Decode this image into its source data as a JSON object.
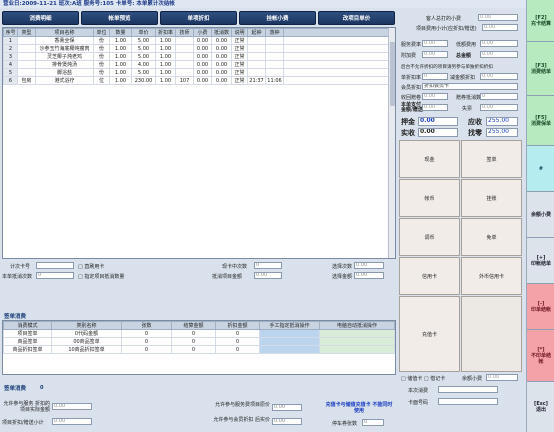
{
  "header": {
    "title": "营业日:2009-11-21 班次:A班 服务号:105 卡单号: 本单累计次结帐"
  },
  "top_buttons": [
    "消费明细",
    "帐单预览",
    "单项折扣",
    "挂帐小费",
    "改项目单价"
  ],
  "grid": {
    "columns": [
      "序号",
      "类型",
      "项目名称",
      "单位",
      "数量",
      "单价",
      "折扣率",
      "技师",
      "小费",
      "抵消数",
      "说明",
      "起钟",
      "落钟"
    ],
    "rows": [
      [
        "1",
        "",
        "香熏全保",
        "份",
        "1.00",
        "5.00",
        "1.00",
        "",
        "0.00",
        "0.00",
        "正常",
        "",
        ""
      ],
      [
        "2",
        "",
        "沙参玉竹海底椰炖瘦肉",
        "份",
        "1.00",
        "5.00",
        "1.00",
        "",
        "0.00",
        "0.00",
        "正常",
        "",
        ""
      ],
      [
        "3",
        "",
        "灵芝椰子炖老鸡",
        "份",
        "1.00",
        "5.00",
        "1.00",
        "",
        "0.00",
        "0.00",
        "正常",
        "",
        ""
      ],
      [
        "4",
        "",
        "排骨煲炖汤",
        "份",
        "1.00",
        "4.00",
        "1.00",
        "",
        "0.00",
        "0.00",
        "正常",
        "",
        ""
      ],
      [
        "5",
        "",
        "脚浴盐",
        "份",
        "1.00",
        "5.00",
        "1.00",
        "",
        "0.00",
        "0.00",
        "正常",
        "",
        ""
      ],
      [
        "6",
        "包房",
        "港式浴疗",
        "位",
        "1.00",
        "230.00",
        "1.00",
        "107",
        "0.00",
        "0.00",
        "正常",
        "21:37",
        "11:06"
      ]
    ]
  },
  "mid": {
    "count_card_label": "计次卡号",
    "count_card_value": "",
    "member_consume_label": "□ 直刷用卡",
    "this_times_label": "本单抵消次数",
    "this_times_value": "0",
    "specify_deduct_label": "□ 指定项目抵消数量",
    "in_card_times_label": "现卡中次数",
    "in_card_times_value": "0",
    "recharge_count_label": "选择次数",
    "recharge_count_value": "0.00",
    "deduct_amount_label": "抵消项目金额",
    "deduct_amount_value": "0.00",
    "choose_money_label": "选择金额",
    "choose_money_value": "0.00"
  },
  "discount": {
    "section_title": "签单消费",
    "columns": [
      "消费模式",
      "类别名称",
      "张数",
      "结算金额",
      "折扣金额",
      "手工指定抵消操作",
      "电脑自动抵消操作"
    ],
    "rows": [
      [
        "项目签单",
        "0代码金额",
        "0",
        "0",
        "0",
        "",
        ""
      ],
      [
        "商品签单",
        "00商品签单",
        "0",
        "0",
        "0",
        "",
        ""
      ],
      [
        "商品折扣签单",
        "10商品折扣签单",
        "0",
        "0",
        "0",
        "",
        ""
      ]
    ],
    "footer_title": "签单消费",
    "footer_value": "0"
  },
  "bottom": {
    "allow_project_label": "允许参与服务 折扣的项目实际金额",
    "allow_project_value": "0.00",
    "free_project_label": "项目折扣/赠送小计",
    "free_project_value": "0.00",
    "member_price_label": "允许参与服务费项目原价",
    "member_price_value": "0.00",
    "total_rate_label": "允许参与会员折扣 后实价",
    "total_rate_value": "0.00",
    "print_label": "充值卡与储值充值卡 不能同时使用",
    "stop_count_label": "停车券张数",
    "stop_count_value": "0"
  },
  "right": {
    "guest_label": "客人总打的小费",
    "guest_value": "0.00",
    "project_total_label": "项目费用小计(应折扣/赠送)",
    "project_total_value": "0.00",
    "service_fee_label": "服务费率",
    "service_fee_value": "0.00",
    "low_fee_label": "低额费用",
    "low_fee_value": "0.00",
    "add_fee_label": "附加费",
    "add_fee_value": "0.00",
    "total_fee_label": "总金额",
    "total_fee_value": "0.00",
    "prompt_label": "后台不允许折扣的项目请另参与单独折扣折扣",
    "single_discount_label": "单折扣率",
    "single_discount_value": "0",
    "reduce_label": "减金额折扣",
    "reduce_value": "0.00",
    "member_rate_label": "会员折扣",
    "member_rate_value": "折扣会员卡",
    "receive_label": "收回赠卷",
    "receive_value": "0.00",
    "ticket_label": "赠券抵消数",
    "ticket_value": "0",
    "this_card_label": "本单支付金额/赠送",
    "this_card_value": "0.00",
    "shortage_label": "失票",
    "shortage_value": "0.00",
    "deposit_label": "押金",
    "deposit_value": "0.00",
    "receivable_label": "应收",
    "receivable_value": "255.00",
    "received_label": "实收",
    "received_value": "0.00",
    "change_label": "找零",
    "change_value": "255.00",
    "payments": [
      "现金",
      "签单",
      "帐币",
      "挂账",
      "调币",
      "免单",
      "信用卡",
      "外币信用卡",
      "充值卡",
      ""
    ],
    "member_card_label": "□ 储值卡  □ 借记卡",
    "member_card_value": "0.00",
    "member_card_amount_label": "余额小费",
    "card_no_label": "本次消费",
    "card_no_value": "",
    "card_code_label": "卡面号码",
    "card_code_value": ""
  },
  "sidebar": [
    {
      "label": "[F2]\n充卡结算",
      "style": "green"
    },
    {
      "label": "[F3]\n消费结单",
      "style": "green"
    },
    {
      "label": "[F5]\n消费保单",
      "style": "green"
    },
    {
      "label": "#",
      "style": "cyan"
    },
    {
      "label": "余额小费",
      "style": "grey"
    },
    {
      "label": "[+]\n印帐结单",
      "style": "grey"
    },
    {
      "label": "[-]\n印单结帐",
      "style": "pink"
    },
    {
      "label": "[*]\n不印单结\n帐",
      "style": "pink"
    },
    {
      "label": "[Esc]\n退出",
      "style": "grey"
    }
  ]
}
